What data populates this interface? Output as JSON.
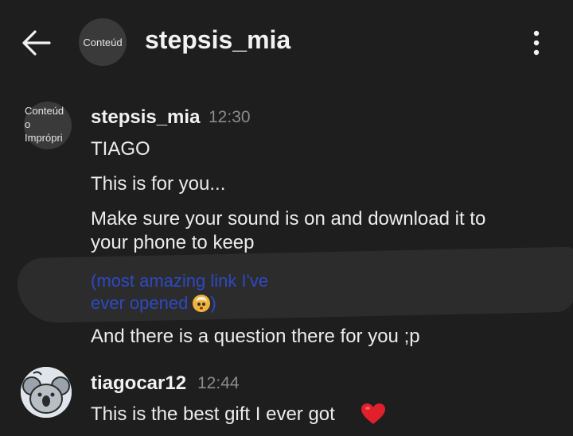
{
  "header": {
    "avatar_text": "Conteúd",
    "title": "stepsis_mia",
    "back_icon": "arrow-left-icon",
    "menu_icon": "more-vertical-icon"
  },
  "messages": [
    {
      "avatar_lines": [
        "Conteúd",
        "o",
        "Imprópri"
      ],
      "sender": "stepsis_mia",
      "time": "12:30",
      "lines": [
        "TIAGO",
        "This is for you...",
        "Make sure your sound is on and download it to",
        "your phone to keep"
      ],
      "link_text_1": "(most amazing link I've",
      "link_text_2": "ever opened",
      "link_text_3": ")",
      "after_link": "And there is a question there for you ;p"
    },
    {
      "sender": "tiagocar12",
      "time": "12:44",
      "text": "This is the best gift I ever got",
      "emoji": "heart-icon"
    }
  ],
  "colors": {
    "background": "#1e1e1e",
    "link": "#2e49c2",
    "timestamp": "#8c8c8c",
    "heart": "#e0202a"
  }
}
